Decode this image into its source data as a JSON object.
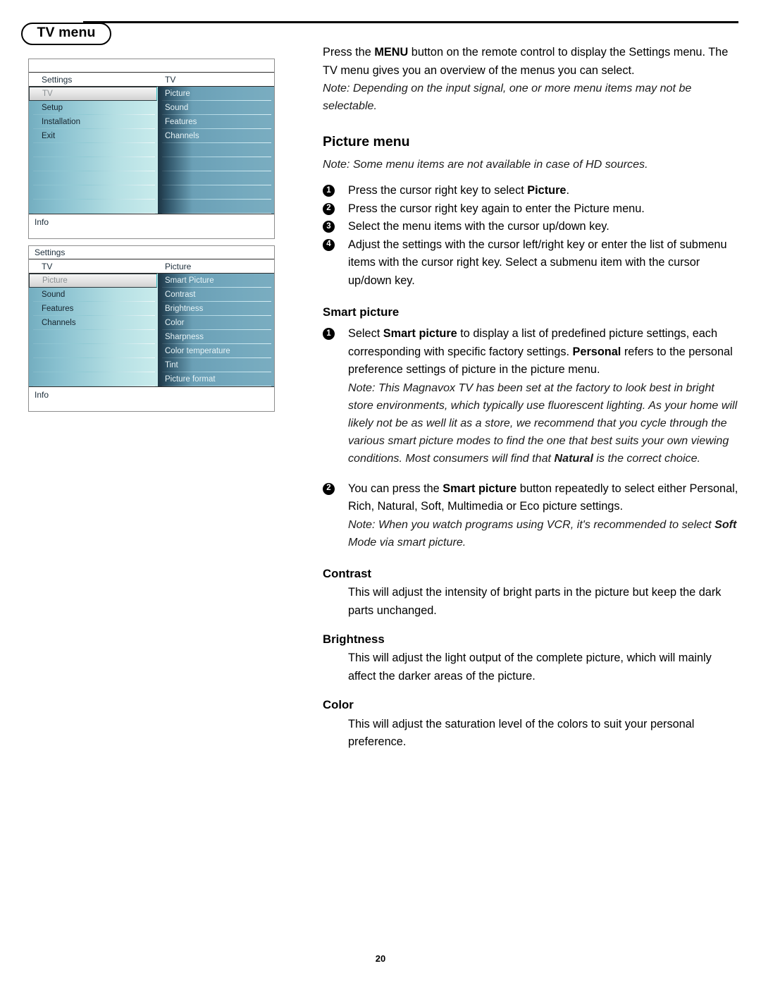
{
  "page": {
    "tab_label": "TV menu",
    "page_number": "20"
  },
  "osd_screens": [
    {
      "title": "",
      "column_headers": {
        "left": "Settings",
        "right": "TV"
      },
      "left_items": [
        "TV",
        "Setup",
        "Installation",
        "Exit"
      ],
      "left_selected": "TV",
      "right_items": [
        "Picture",
        "Sound",
        "Features",
        "Channels"
      ],
      "footer": "Info"
    },
    {
      "title": "Settings",
      "column_headers": {
        "left": "TV",
        "right": "Picture"
      },
      "left_items": [
        "Picture",
        "Sound",
        "Features",
        "Channels"
      ],
      "left_selected": "Picture",
      "right_items": [
        "Smart Picture",
        "Contrast",
        "Brightness",
        "Color",
        "Sharpness",
        "Color temperature",
        "Tint",
        "Picture format"
      ],
      "footer": "Info"
    }
  ],
  "intro": {
    "p1_a": "Press the ",
    "p1_b": "MENU",
    "p1_c": " button on the remote control to display the Settings menu. The TV menu gives you an overview of the menus you can select.",
    "note": "Note: Depending on the input signal, one or more menu items may not be selectable."
  },
  "picture_menu": {
    "heading": "Picture menu",
    "note": "Note: Some menu items are not available in case of HD sources.",
    "steps": [
      {
        "num": "1",
        "a": "Press the cursor right key to select ",
        "b": "Picture",
        "c": "."
      },
      {
        "num": "2",
        "a": "Press the cursor right key again to enter the Picture menu.",
        "b": "",
        "c": ""
      },
      {
        "num": "3",
        "a": "Select the menu items with the cursor up/down key.",
        "b": "",
        "c": ""
      },
      {
        "num": "4",
        "a": "Adjust the settings with the cursor left/right key or enter the list of submenu items with the cursor right key. Select a submenu item with the cursor up/down key.",
        "b": "",
        "c": ""
      }
    ]
  },
  "smart_picture": {
    "heading": "Smart picture",
    "step1": {
      "num": "1",
      "a": "Select ",
      "b": "Smart picture",
      "c": " to display a list of predefined picture settings, each corresponding with specific factory settings. ",
      "d": "Personal",
      "e": " refers to the personal preference settings of picture in the picture menu."
    },
    "step1_note_a": "Note: This Magnavox TV has been set at the factory to look best in bright store environments, which typically use fluorescent lighting. As your home will likely not be as well lit as a store, we recommend that you cycle through the various smart picture modes to find the one that best suits your own viewing conditions. Most consumers will find that ",
    "step1_note_b": "Natural",
    "step1_note_c": " is the correct choice.",
    "step2": {
      "num": "2",
      "a": "You can press the ",
      "b": "Smart picture",
      "c": " button repeatedly to select either Personal, Rich, Natural, Soft, Multimedia or Eco picture settings."
    },
    "step2_note_a": "Note: When you watch programs using VCR, it's recommended to select ",
    "step2_note_b": "Soft",
    "step2_note_c": " Mode via smart picture."
  },
  "contrast": {
    "heading": "Contrast",
    "body": "This will adjust the intensity of bright parts in the picture but keep the dark parts unchanged."
  },
  "brightness": {
    "heading": "Brightness",
    "body": "This will adjust the light output of the complete picture, which will mainly affect the darker areas of the picture."
  },
  "color": {
    "heading": "Color",
    "body": "This will adjust the saturation level of the colors to suit your personal preference."
  }
}
